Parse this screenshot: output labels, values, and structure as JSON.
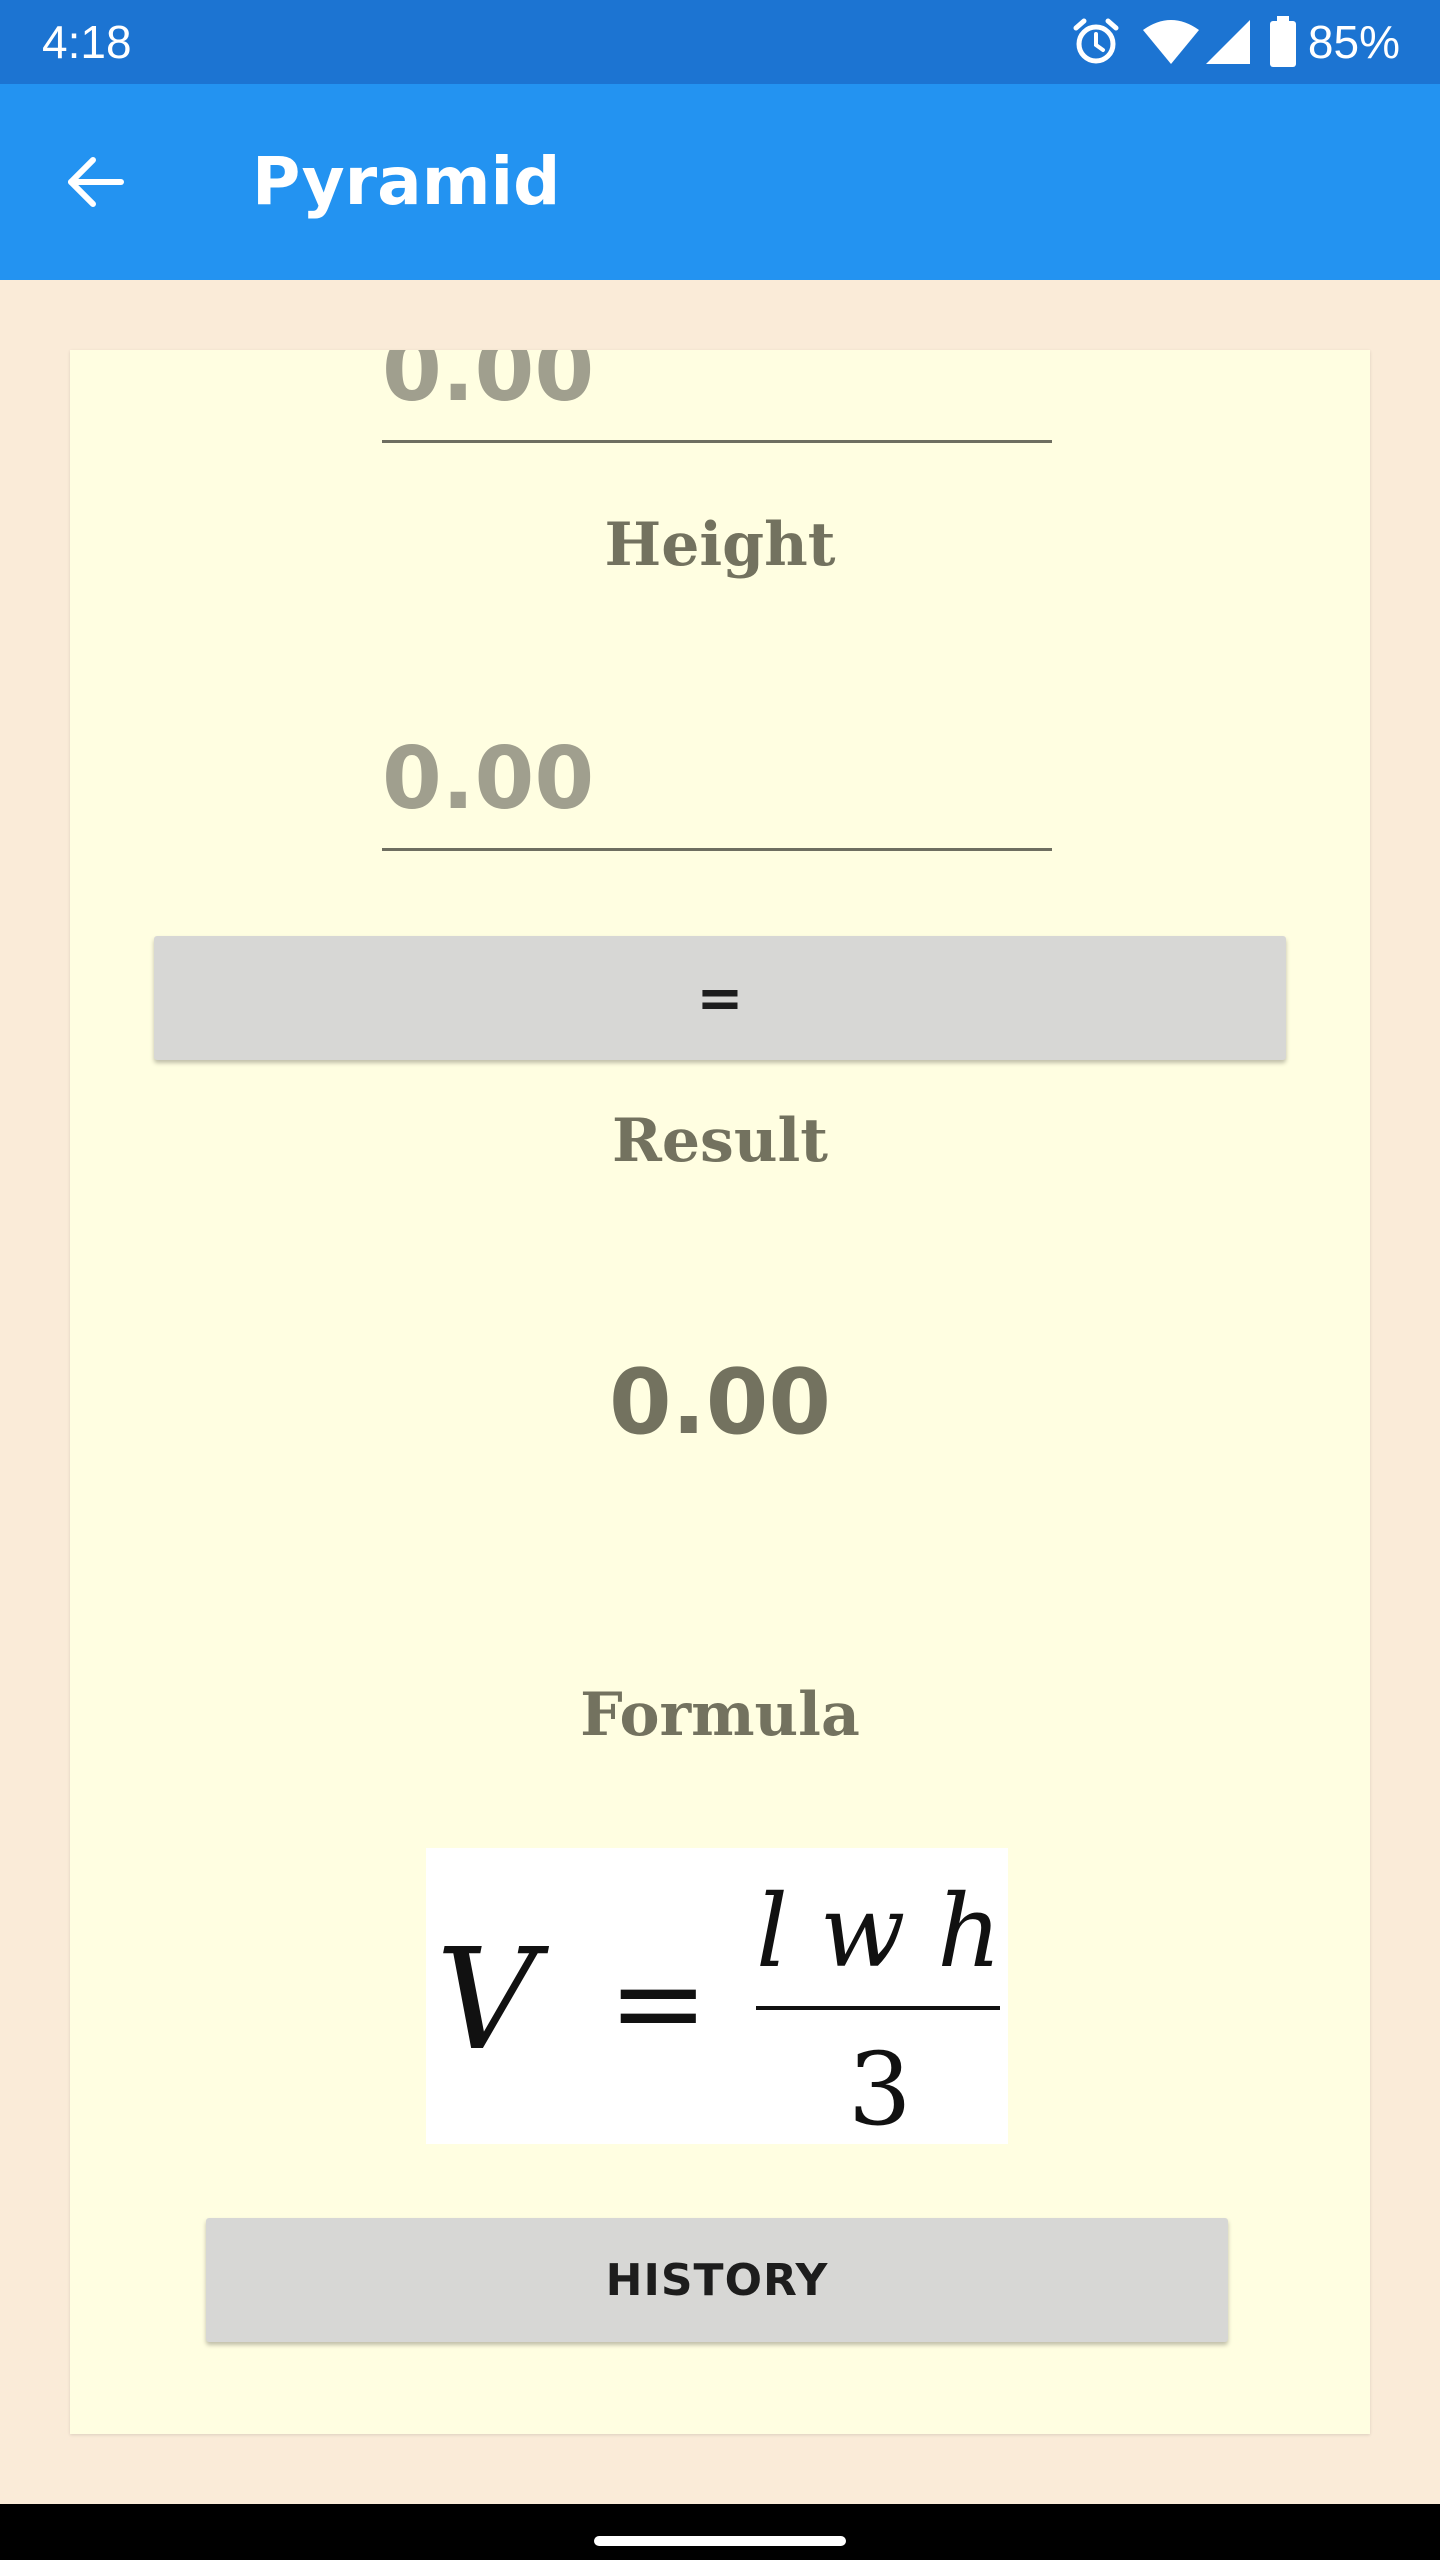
{
  "status_bar": {
    "time": "4:18",
    "battery_percent": "85%",
    "icons": [
      "alarm-icon",
      "wifi-icon",
      "signal-icon",
      "battery-icon"
    ]
  },
  "app_bar": {
    "title": "Pyramid",
    "back_icon": "arrow-back-icon"
  },
  "form": {
    "top_field_value": "0.00",
    "height_label": "Height",
    "height_value": "0.00",
    "equals_label": "=",
    "result_label": "Result",
    "result_value": "0.00",
    "formula_label": "Formula",
    "formula": {
      "lhs": "V",
      "equals": "=",
      "numerator": "l w h",
      "denominator": "3"
    },
    "history_label": "HISTORY"
  },
  "colors": {
    "status_bar": "#1c74d2",
    "app_bar": "#2393f1",
    "background": "#faebd8",
    "card": "#fffee1",
    "label_text": "#73725f",
    "button": "#d7d7d5"
  }
}
